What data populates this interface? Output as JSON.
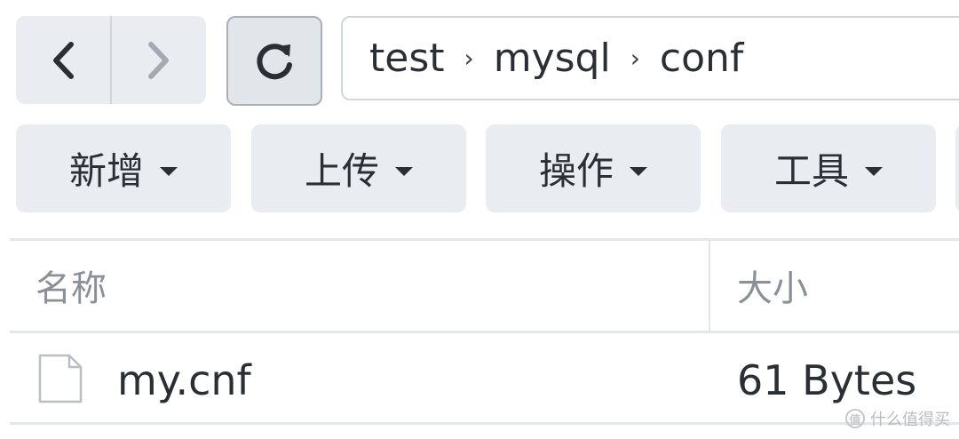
{
  "nav": {
    "back_icon": "chevron-left-icon",
    "forward_icon": "chevron-right-icon",
    "refresh_icon": "refresh-icon"
  },
  "breadcrumb": {
    "items": [
      "test",
      "mysql",
      "conf"
    ],
    "separator": "›"
  },
  "toolbar": {
    "buttons": [
      {
        "label": "新增"
      },
      {
        "label": "上传"
      },
      {
        "label": "操作"
      },
      {
        "label": "工具"
      }
    ]
  },
  "file_list": {
    "columns": [
      "名称",
      "大小"
    ],
    "rows": [
      {
        "icon": "file-icon",
        "name": "my.cnf",
        "size": "61 Bytes"
      }
    ]
  },
  "watermark": {
    "badge": "值",
    "text": "什么值得买"
  },
  "colors": {
    "button_bg": "#e9edf2",
    "border": "#d1d6dc",
    "text": "#2a2f36",
    "muted_text": "#8a9098"
  }
}
